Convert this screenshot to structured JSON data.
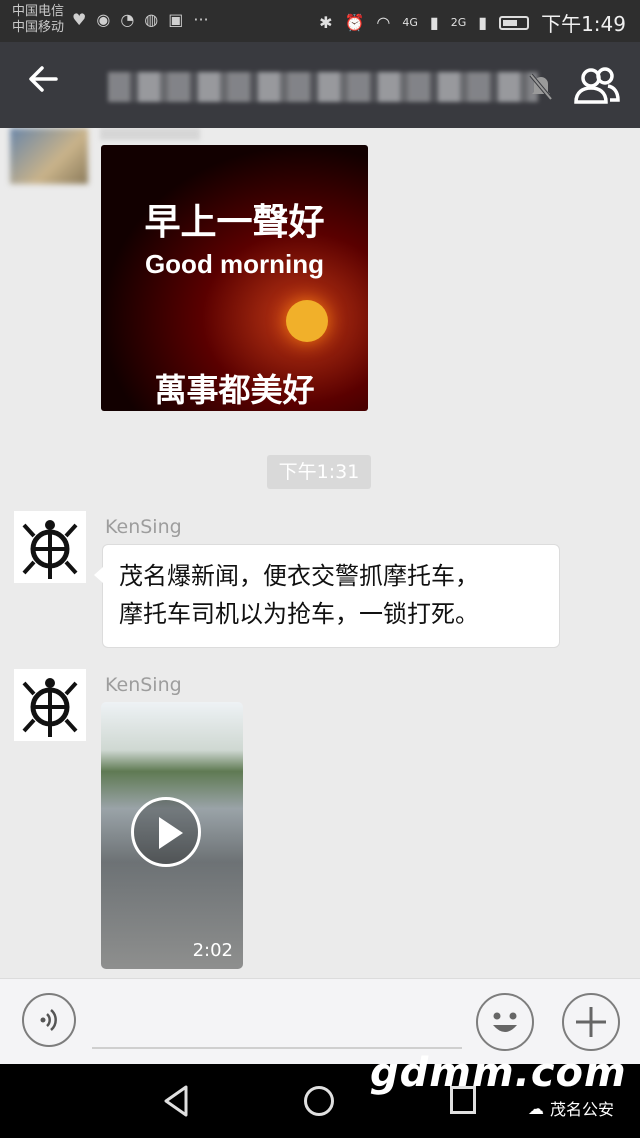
{
  "status": {
    "carrier1": "中国电信",
    "carrier2": "中国移动",
    "network1": "4G",
    "network2": "2G",
    "time": "下午1:49"
  },
  "header": {
    "back_icon": "arrow-left-icon",
    "members_icon": "group-members-icon"
  },
  "messages": {
    "image_top": "早上一聲好",
    "image_middle": "Good morning",
    "image_bottom": "萬事都美好",
    "timestamp": "下午1:31",
    "sender1": "KenSing",
    "text_line1": "茂名爆新闻，便衣交警抓摩托车，",
    "text_line2": "摩托车司机以为抢车，一锁打死。",
    "sender2": "KenSing",
    "video_duration": "2:02"
  },
  "watermark": {
    "site": "gdmm.com",
    "badge": "茂名公安"
  }
}
